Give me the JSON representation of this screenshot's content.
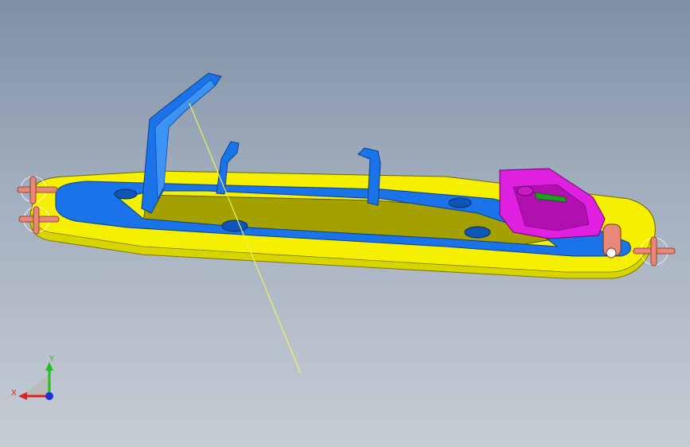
{
  "viewport": {
    "background_top": "#7f90a6",
    "background_bottom": "#c6ccd5"
  },
  "model": {
    "colors": {
      "tray_yellow": "#f4f000",
      "tray_olive": "#a4a000",
      "part_blue": "#1a73e8",
      "part_blue_dark": "#0a3f8c",
      "mechanism_magenta": "#e020e0",
      "spring_green": "#20a020",
      "pin_salmon": "#e88878",
      "section_line": "#f0f060"
    }
  },
  "triad": {
    "x_label": "X",
    "y_label": "Y",
    "x_color": "#e02020",
    "y_color": "#20c020",
    "z_color": "#2030e0",
    "icon": "coordinate-triad-icon"
  }
}
